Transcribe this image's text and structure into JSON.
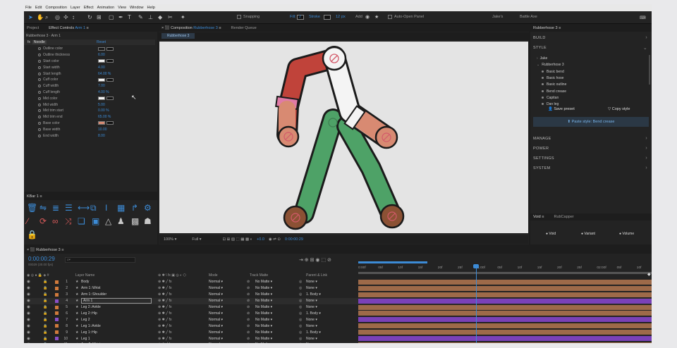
{
  "menu": [
    "File",
    "Edit",
    "Composition",
    "Layer",
    "Effect",
    "Animation",
    "View",
    "Window",
    "Help"
  ],
  "toolbar": {
    "snapping_label": "Snapping",
    "fill_label": "Fill:",
    "fill_value": "2",
    "stroke_label": "Stroke",
    "stroke_value": "12",
    "stroke_unit": "px",
    "add_label": "Add",
    "auto_open_label": "Auto-Open Panel",
    "workspace_1": "Jake's",
    "workspace_2": "Battle Axe"
  },
  "project_panel": {
    "project_tab": "Project",
    "ec_tab_prefix": "Effect Controls",
    "ec_tab_layer": "Arm 1",
    "breadcrumb": "Rubberhose 3 · Arm 1",
    "effect_name": "Noodle",
    "effect_reset": "Reset",
    "properties": [
      {
        "label": "Outline color",
        "value": "",
        "swatch": "#1a1a1a"
      },
      {
        "label": "Outline thickness",
        "value": "6.00",
        "swatch": ""
      },
      {
        "label": "Start color",
        "value": "",
        "swatch": "#f2f2f2"
      },
      {
        "label": "Start width",
        "value": "4.00",
        "swatch": ""
      },
      {
        "label": "Start length",
        "value": "64.00 %",
        "swatch": ""
      },
      {
        "label": "Cuff color",
        "value": "",
        "swatch": "#f2f2f2"
      },
      {
        "label": "Cuff width",
        "value": "7.00",
        "swatch": ""
      },
      {
        "label": "Cuff length",
        "value": "4.00 %",
        "swatch": ""
      },
      {
        "label": "Mid color",
        "value": "",
        "swatch": "#f2f2f2"
      },
      {
        "label": "Mid width",
        "value": "5.00",
        "swatch": ""
      },
      {
        "label": "Mid trim start",
        "value": "0.00 %",
        "swatch": ""
      },
      {
        "label": "Mid trim end",
        "value": "65.00 %",
        "swatch": ""
      },
      {
        "label": "Base color",
        "value": "",
        "swatch": "#d88a72"
      },
      {
        "label": "Base width",
        "value": "10.00",
        "swatch": ""
      },
      {
        "label": "End width",
        "value": "8.00",
        "swatch": ""
      }
    ]
  },
  "kbar": {
    "title": "KBar 1"
  },
  "composition": {
    "tab_prefix": "Composition",
    "tab_name": "Rubberhose 3",
    "render_queue_tab": "Render Queue",
    "sub_tab": "Rubberhose 3",
    "zoom": "100%",
    "resolution": "Full",
    "exposure": "+0.0",
    "timecode": "0:00:00:29"
  },
  "rubberhose_panel": {
    "title": "Rubberhose 3",
    "build": "BUILD",
    "style": "STYLE",
    "style_items": [
      "Jake",
      "Rubberhose 3",
      "Basic bend",
      "Basic hose",
      "Basic outline",
      "Bend crease",
      "Capitan",
      "Dan leg"
    ],
    "save_preset": "Save preset",
    "copy_style": "Copy style",
    "paste_style": "Paste style: Bend crease",
    "manage": "MANAGE",
    "power": "POWER",
    "settings": "SETTINGS",
    "system": "SYSTEM",
    "void_tab": "Void",
    "rubberhose_tab": "RubCapper",
    "bottom_buttons": [
      "Void",
      "Variant",
      "Volume"
    ]
  },
  "timeline": {
    "comp_tab": "Rubberhose 3",
    "current_time": "0:00:00:29",
    "fps_note": "00029 (30.00 fps)",
    "headers": {
      "layer_name": "Layer Name",
      "mode": "Mode",
      "track_matte": "Track Matte",
      "parent": "Parent & Link"
    },
    "ruler": [
      "0:00f",
      "05f",
      "10f",
      "15f",
      "20f",
      "25f",
      "1:00f",
      "05f",
      "10f",
      "15f",
      "20f",
      "25f",
      "02:00f",
      "05f",
      "10f"
    ],
    "layers": [
      {
        "num": "1",
        "name": "Body",
        "mode": "Normal",
        "matte": "No Matte",
        "parent": "None",
        "chip": "#d07a3c",
        "bar": "#9d6a49"
      },
      {
        "num": "2",
        "name": "Arm 1::Wrist",
        "mode": "Normal",
        "matte": "No Matte",
        "parent": "None",
        "chip": "#d07a3c",
        "bar": "#9d6a49"
      },
      {
        "num": "3",
        "name": "Arm 1::Shoulder",
        "mode": "Normal",
        "matte": "No Matte",
        "parent": "1. Body",
        "chip": "#d07a3c",
        "bar": "#9d6a49"
      },
      {
        "num": "4",
        "name": "Arm 1",
        "mode": "Normal",
        "matte": "No Matte",
        "parent": "None",
        "chip": "#8a4fc8",
        "bar": "#7a41b8"
      },
      {
        "num": "5",
        "name": "Leg 2::Ankle",
        "mode": "Normal",
        "matte": "No Matte",
        "parent": "None",
        "chip": "#d07a3c",
        "bar": "#9d6a49"
      },
      {
        "num": "6",
        "name": "Leg 2::Hip",
        "mode": "Normal",
        "matte": "No Matte",
        "parent": "1. Body",
        "chip": "#d07a3c",
        "bar": "#9d6a49"
      },
      {
        "num": "7",
        "name": "Leg 2",
        "mode": "Normal",
        "matte": "No Matte",
        "parent": "None",
        "chip": "#8a4fc8",
        "bar": "#7a41b8"
      },
      {
        "num": "8",
        "name": "Leg 1::Ankle",
        "mode": "Normal",
        "matte": "No Matte",
        "parent": "None",
        "chip": "#d07a3c",
        "bar": "#9d6a49"
      },
      {
        "num": "9",
        "name": "Leg 1::Hip",
        "mode": "Normal",
        "matte": "No Matte",
        "parent": "1. Body",
        "chip": "#d07a3c",
        "bar": "#9d6a49"
      },
      {
        "num": "10",
        "name": "Leg 1",
        "mode": "Normal",
        "matte": "No Matte",
        "parent": "None",
        "chip": "#8a4fc8",
        "bar": "#7a41b8"
      },
      {
        "num": "11",
        "name": "Arm 2::Wrist",
        "mode": "Normal",
        "matte": "No Matte",
        "parent": "None",
        "chip": "#d07a3c",
        "bar": "#9d6a49"
      }
    ]
  }
}
